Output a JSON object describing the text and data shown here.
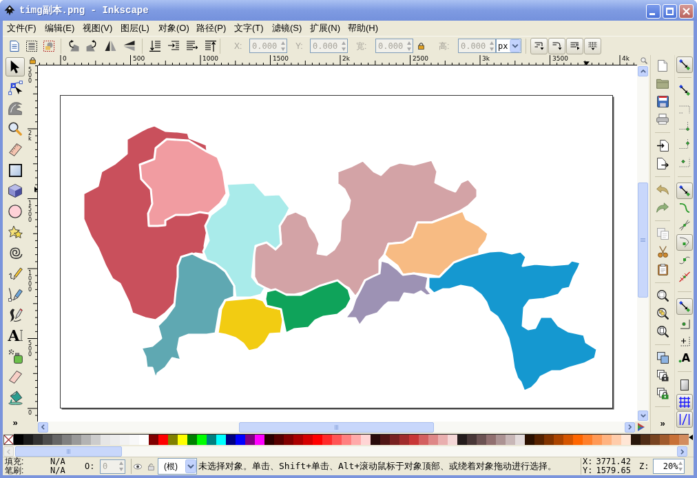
{
  "window": {
    "title": "timg副本.png - Inkscape"
  },
  "menu": [
    "文件(F)",
    "编辑(E)",
    "视图(V)",
    "图层(L)",
    "对象(O)",
    "路径(P)",
    "文字(T)",
    "滤镜(S)",
    "扩展(N)",
    "帮助(H)"
  ],
  "toolbar": {
    "fields": [
      {
        "label": "X:",
        "value": "0.000",
        "disabled": true
      },
      {
        "label": "Y:",
        "value": "0.000",
        "disabled": true
      },
      {
        "label": "宽:",
        "value": "0.000",
        "disabled": true
      },
      {
        "label": "高:",
        "value": "0.000",
        "disabled": true
      }
    ],
    "unit": "px"
  },
  "tools": [
    {
      "selected": true
    },
    {
      "selected": false
    },
    {
      "selected": false
    },
    {
      "selected": false
    },
    {
      "selected": false
    },
    {
      "selected": false
    },
    {
      "selected": false
    },
    {
      "selected": false
    },
    {
      "selected": false
    },
    {
      "selected": false
    },
    {
      "selected": false
    },
    {
      "selected": false
    },
    {
      "selected": false
    },
    {
      "selected": false,
      "glyph": "A"
    },
    {
      "selected": false
    },
    {
      "selected": false
    },
    {
      "selected": false
    }
  ],
  "tools_more": "»",
  "rulers": {
    "horizontal": [
      "0",
      "500",
      "1000",
      "1500",
      "2k",
      "2500",
      "3k",
      "3500",
      "4k"
    ],
    "vertical": [
      "500",
      "2k",
      "1500",
      "1000",
      "500",
      "0"
    ]
  },
  "map_regions": [
    {
      "color": "#c9505c"
    },
    {
      "color": "#f19ca1"
    },
    {
      "color": "#d3a3a6"
    },
    {
      "color": "#a9ebea"
    },
    {
      "color": "#5fa8b2"
    },
    {
      "color": "#f2cc12"
    },
    {
      "color": "#0fa35a"
    },
    {
      "color": "#f7bb83"
    },
    {
      "color": "#9d92b4"
    },
    {
      "color": "#1598d0"
    }
  ],
  "commands_more": "»",
  "snap_buttons": [
    {
      "on": true
    },
    {
      "on": false
    },
    {
      "on": false
    },
    {
      "on": false
    },
    {
      "on": false
    },
    {
      "on": false
    },
    {
      "on": true
    },
    {
      "on": false
    },
    {
      "on": false
    },
    {
      "on": true
    },
    {
      "on": false
    },
    {
      "on": false
    },
    {
      "on": true
    },
    {
      "on": false
    },
    {
      "on": false
    },
    {
      "on": false,
      "glyph": "A"
    },
    {
      "on": false
    },
    {
      "on": true
    },
    {
      "on": true
    }
  ],
  "palette": [
    {
      "color": "#000000"
    },
    {
      "color": "#1a1a1a"
    },
    {
      "color": "#333333"
    },
    {
      "color": "#4d4d4d"
    },
    {
      "color": "#666666"
    },
    {
      "color": "#808080"
    },
    {
      "color": "#999999"
    },
    {
      "color": "#b3b3b3"
    },
    {
      "color": "#cccccc"
    },
    {
      "color": "#e6e6e6"
    },
    {
      "color": "#ececec"
    },
    {
      "color": "#f2f2f2"
    },
    {
      "color": "#f8f8f8"
    },
    {
      "color": "#ffffff"
    },
    {
      "color": "#800000"
    },
    {
      "color": "#ff0000"
    },
    {
      "color": "#808000"
    },
    {
      "color": "#ffff00"
    },
    {
      "color": "#008000"
    },
    {
      "color": "#00ff00"
    },
    {
      "color": "#008080"
    },
    {
      "color": "#00ffff"
    },
    {
      "color": "#000080"
    },
    {
      "color": "#0000ff"
    },
    {
      "color": "#800080"
    },
    {
      "color": "#ff00ff"
    },
    {
      "color": "#2b0000"
    },
    {
      "color": "#550000"
    },
    {
      "color": "#800000"
    },
    {
      "color": "#aa0000"
    },
    {
      "color": "#d40000"
    },
    {
      "color": "#ff0000"
    },
    {
      "color": "#ff2a2a"
    },
    {
      "color": "#ff5555"
    },
    {
      "color": "#ff8080"
    },
    {
      "color": "#ffaaaa"
    },
    {
      "color": "#ffd5d5"
    },
    {
      "color": "#280b0b"
    },
    {
      "color": "#501616"
    },
    {
      "color": "#782121"
    },
    {
      "color": "#a02c2c"
    },
    {
      "color": "#c83737"
    },
    {
      "color": "#d35f5f"
    },
    {
      "color": "#de8787"
    },
    {
      "color": "#e9afaf"
    },
    {
      "color": "#f4d7d7"
    },
    {
      "color": "#241c1c"
    },
    {
      "color": "#483737"
    },
    {
      "color": "#6c5353"
    },
    {
      "color": "#917070"
    },
    {
      "color": "#ac9393"
    },
    {
      "color": "#c8b7b7"
    },
    {
      "color": "#e3dbdb"
    },
    {
      "color": "#2b1100"
    },
    {
      "color": "#552200"
    },
    {
      "color": "#803300"
    },
    {
      "color": "#aa4400"
    },
    {
      "color": "#d45500"
    },
    {
      "color": "#ff6600"
    },
    {
      "color": "#ff7f2a"
    },
    {
      "color": "#ff9955"
    },
    {
      "color": "#ffb380"
    },
    {
      "color": "#ffccaa"
    },
    {
      "color": "#ffe6d5"
    },
    {
      "color": "#28170b"
    },
    {
      "color": "#502d16"
    },
    {
      "color": "#784421"
    },
    {
      "color": "#a05a2c"
    },
    {
      "color": "#c87137"
    },
    {
      "color": "#d38d5f"
    }
  ],
  "status": {
    "fill_label": "填充:",
    "fill_value": "N/A",
    "stroke_label": "笔刷:",
    "stroke_value": "N/A",
    "opacity": {
      "label": "O:",
      "value": "0",
      "disabled": true
    },
    "layer": "(根)",
    "message": "未选择对象。单击、Shift+单击、Alt+滚动鼠标于对象顶部、或绕着对象拖动进行选择。",
    "x_label": "X:",
    "x_value": "3771.42",
    "y_label": "Y:",
    "y_value": "1579.65",
    "zoom_label": "Z:",
    "zoom_value": "20%"
  }
}
